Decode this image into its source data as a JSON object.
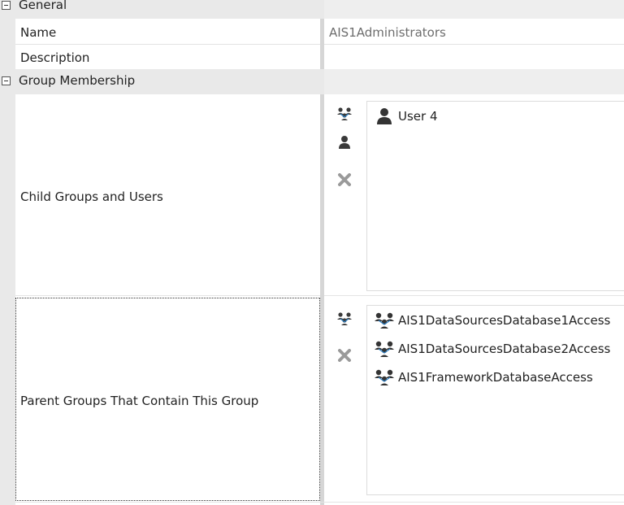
{
  "categories": {
    "general": "General",
    "group_membership": "Group Membership"
  },
  "properties": {
    "name_label": "Name",
    "name_value": "AIS1Administrators",
    "description_label": "Description",
    "child_label": "Child Groups and Users",
    "parent_label": "Parent Groups That Contain This Group"
  },
  "child_members": [
    {
      "label": "User 4",
      "icon": "user-icon"
    }
  ],
  "parent_groups": [
    {
      "label": "AIS1DataSourcesDatabase1Access",
      "icon": "group-icon"
    },
    {
      "label": "AIS1DataSourcesDatabase2Access",
      "icon": "group-icon"
    },
    {
      "label": "AIS1FrameworkDatabaseAccess",
      "icon": "group-icon"
    }
  ],
  "colors": {
    "icon": "#3a3a3a",
    "icon_accent": "#2f7fc1",
    "remove_icon": "#9a9a9a"
  }
}
